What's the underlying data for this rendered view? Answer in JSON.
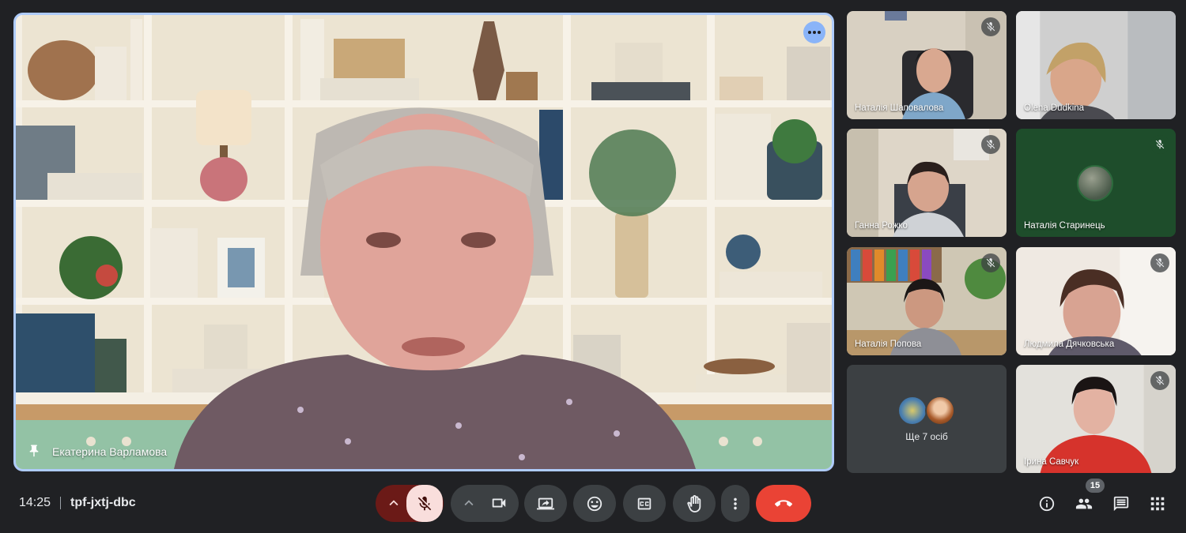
{
  "main_speaker": {
    "name": "Екатерина Варламова",
    "pinned_icon": "pin-icon",
    "more_options_icon": "more-horiz-icon"
  },
  "participants": [
    {
      "name": "Наталія Шаповалова",
      "muted": true
    },
    {
      "name": "Olena Dudkina",
      "muted": false
    },
    {
      "name": "Ганна Рожко",
      "muted": true
    },
    {
      "name": "Наталія Старинець",
      "muted": true,
      "avatar_only": true
    },
    {
      "name": "Наталія Попова",
      "muted": true
    },
    {
      "name": "Людмила Дячковська",
      "muted": true
    },
    {
      "name": "Ірина Савчук",
      "muted": true
    }
  ],
  "others_tile": {
    "label": "Ще 7 осіб"
  },
  "meeting": {
    "time": "14:25",
    "code": "tpf-jxtj-dbc"
  },
  "controls": {
    "mic_state": "muted",
    "icons": [
      "chevron-up-icon",
      "mic-off-icon",
      "chevron-up-icon",
      "camera-icon",
      "present-screen-icon",
      "emoji-icon",
      "captions-icon",
      "raise-hand-icon",
      "more-vert-icon",
      "end-call-icon"
    ]
  },
  "right_panel": {
    "participant_count": "15",
    "icons": [
      "info-icon",
      "people-icon",
      "chat-icon",
      "activities-icon"
    ]
  },
  "colors": {
    "background": "#202124",
    "active_speaker_border": "#aecbfa",
    "end_call": "#ea4335",
    "mic_muted_bg": "#f9dedc",
    "mic_group_bg": "#6b1a17",
    "control_bg": "#3c4043"
  }
}
